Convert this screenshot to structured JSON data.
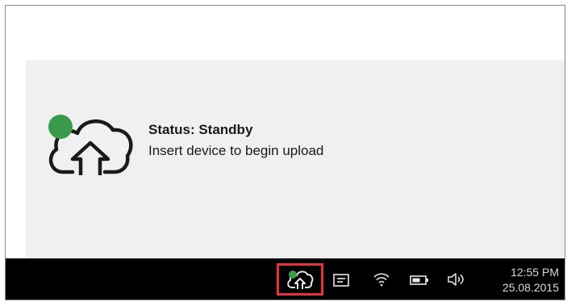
{
  "status": {
    "title": "Status: Standby",
    "message": "Insert device to begin upload",
    "indicator_color": "#3a9a4a",
    "icon": "cloud-upload-icon"
  },
  "taskbar": {
    "background": "#000000",
    "items": [
      {
        "icon": "cloud-upload-icon",
        "highlighted": true,
        "highlight_color": "#e0343a"
      },
      {
        "icon": "action-center-icon"
      },
      {
        "icon": "wifi-icon"
      },
      {
        "icon": "battery-icon"
      },
      {
        "icon": "volume-icon"
      }
    ],
    "clock": {
      "time": "12:55 PM",
      "date": "25.08.2015"
    }
  }
}
